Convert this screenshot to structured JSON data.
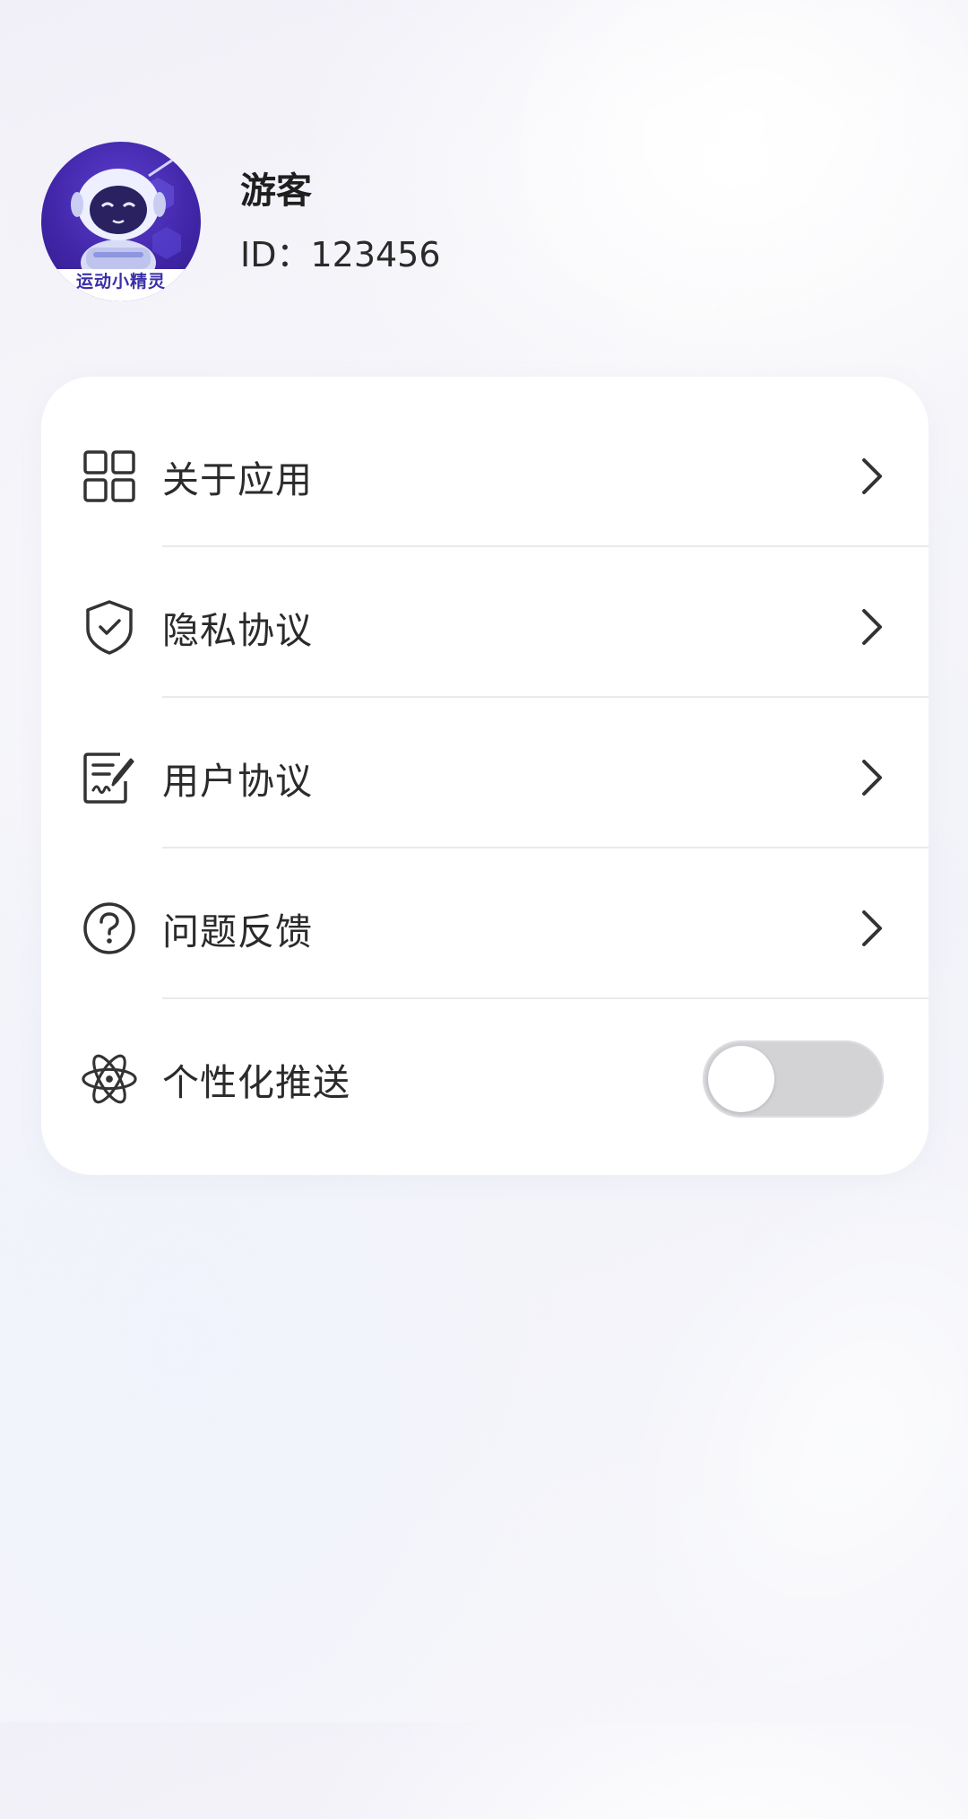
{
  "profile": {
    "name": "游客",
    "id_text": "ID：123456",
    "avatar_caption": "运动小精灵",
    "avatar_icon": "robot-mascot-icon"
  },
  "menu": {
    "about": {
      "label": "关于应用",
      "icon": "grid-icon"
    },
    "privacy": {
      "label": "隐私协议",
      "icon": "shield-check-icon"
    },
    "user_agreement": {
      "label": "用户协议",
      "icon": "document-edit-icon"
    },
    "feedback": {
      "label": "问题反馈",
      "icon": "question-circle-icon"
    },
    "push": {
      "label": "个性化推送",
      "icon": "atom-icon",
      "enabled": false
    }
  },
  "colors": {
    "avatar_bg": "#4126a8",
    "toggle_off": "#d3d3d6",
    "text": "#2b2b2b"
  }
}
